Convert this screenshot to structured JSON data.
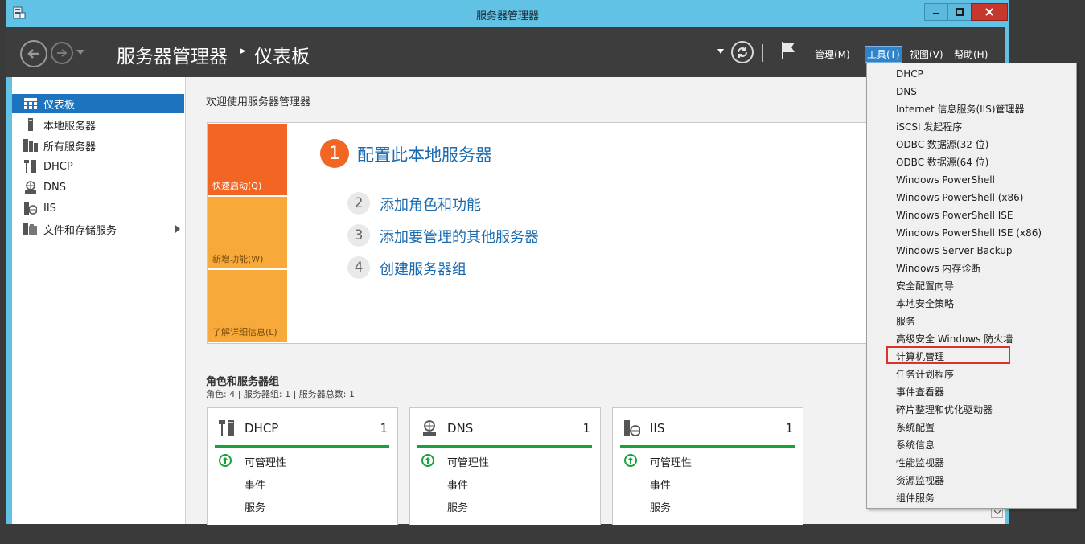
{
  "window": {
    "title": "服务器管理器"
  },
  "header": {
    "breadcrumb_root": "服务器管理器",
    "breadcrumb_sep": "▸",
    "breadcrumb_page": "仪表板",
    "menus": {
      "manage": "管理(M)",
      "tools": "工具(T)",
      "view": "视图(V)",
      "help": "帮助(H)"
    }
  },
  "sidebar": {
    "items": [
      {
        "label": "仪表板",
        "icon": "dashboard-icon",
        "active": true
      },
      {
        "label": "本地服务器",
        "icon": "local-server-icon"
      },
      {
        "label": "所有服务器",
        "icon": "all-servers-icon"
      },
      {
        "label": "DHCP",
        "icon": "dhcp-icon"
      },
      {
        "label": "DNS",
        "icon": "dns-icon"
      },
      {
        "label": "IIS",
        "icon": "iis-icon"
      },
      {
        "label": "文件和存储服务",
        "icon": "file-storage-icon",
        "has_submenu": true
      }
    ]
  },
  "main": {
    "welcome": "欢迎使用服务器管理器",
    "tiles": {
      "quick": "快速启动(Q)",
      "new": "新增功能(W)",
      "learn": "了解详细信息(L)"
    },
    "steps": [
      {
        "num": "1",
        "label": "配置此本地服务器"
      },
      {
        "num": "2",
        "label": "添加角色和功能"
      },
      {
        "num": "3",
        "label": "添加要管理的其他服务器"
      },
      {
        "num": "4",
        "label": "创建服务器组"
      }
    ],
    "roles_title": "角色和服务器组",
    "roles_summary": "角色: 4 | 服务器组: 1 | 服务器总数: 1",
    "role_cards": [
      {
        "name": "DHCP",
        "count": "1",
        "icon": "dhcp-icon",
        "lines": [
          "可管理性",
          "事件",
          "服务"
        ]
      },
      {
        "name": "DNS",
        "count": "1",
        "icon": "dns-icon",
        "lines": [
          "可管理性",
          "事件",
          "服务"
        ]
      },
      {
        "name": "IIS",
        "count": "1",
        "icon": "iis-icon",
        "lines": [
          "可管理性",
          "事件",
          "服务"
        ]
      }
    ]
  },
  "tools_menu": {
    "items": [
      "DHCP",
      "DNS",
      "Internet 信息服务(IIS)管理器",
      "iSCSI 发起程序",
      "ODBC 数据源(32 位)",
      "ODBC 数据源(64 位)",
      "Windows PowerShell",
      "Windows PowerShell (x86)",
      "Windows PowerShell ISE",
      "Windows PowerShell ISE (x86)",
      "Windows Server Backup",
      "Windows 内存诊断",
      "安全配置向导",
      "本地安全策略",
      "服务",
      "高级安全 Windows 防火墙",
      "计算机管理",
      "任务计划程序",
      "事件查看器",
      "碎片整理和优化驱动器",
      "系统配置",
      "系统信息",
      "性能监视器",
      "资源监视器",
      "组件服务"
    ],
    "highlighted": "计算机管理"
  },
  "colors": {
    "accent": "#1c74be",
    "quick_tile": "#f26522",
    "tile": "#f7a93a",
    "ok": "#18a33a",
    "highlight_border": "#e0302a"
  }
}
